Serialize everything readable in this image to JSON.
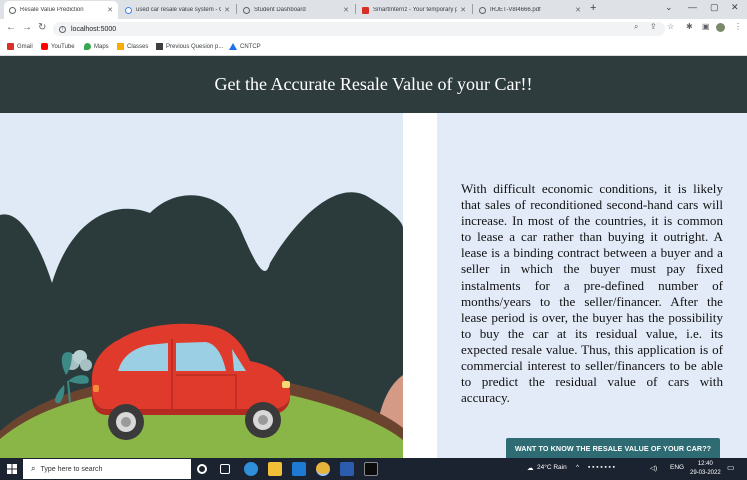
{
  "browser": {
    "tabs": [
      {
        "title": "Resale Value Prediction",
        "active": true,
        "favicon_color": "#1a73e8"
      },
      {
        "title": "used car resale value system - G",
        "active": false,
        "favicon_color": "#4285f4"
      },
      {
        "title": "Student Dashboard",
        "active": false,
        "favicon_color": "#5f6368"
      },
      {
        "title": "SmartInternz - Your temporary p",
        "active": false,
        "favicon_color": "#d93025"
      },
      {
        "title": "IRJET-V8I4666.pdf",
        "active": false,
        "favicon_color": "#5f6368"
      }
    ],
    "new_tab_label": "+",
    "address": "localhost:5000",
    "bookmarks": [
      {
        "label": "Gmail",
        "icon": "gmail-icon",
        "color": "#d93025"
      },
      {
        "label": "YouTube",
        "icon": "youtube-icon",
        "color": "#ff0000"
      },
      {
        "label": "Maps",
        "icon": "maps-icon",
        "color": "#34a853"
      },
      {
        "label": "Classes",
        "icon": "classes-icon",
        "color": "#f9ab00"
      },
      {
        "label": "Previous Quesion p...",
        "icon": "document-icon",
        "color": "#3c4043"
      },
      {
        "label": "CNTCP",
        "icon": "drive-icon",
        "color": "#1a73e8"
      }
    ]
  },
  "page": {
    "heading": "Get the Accurate Resale Value of your Car!!",
    "description": "With difficult economic conditions, it is likely that sales of reconditioned second-hand cars will increase. In most of the countries, it is common to lease a car rather than buying it outright. A lease is a binding contract between a buyer and a seller in which the buyer must pay fixed instalments for a pre-defined number of months/years to the seller/financer. After the lease period is over, the buyer has the possibility to buy the car at its residual value, i.e. its expected resale value. Thus, this application is of commercial interest to seller/financers to be able to predict the residual value of cars with accuracy.",
    "cta_label": "WANT TO KNOW THE RESALE VALUE OF YOUR CAR??",
    "colors": {
      "banner": "#2e3c3e",
      "cta": "#2e6b73",
      "car_body": "#e03a2c",
      "hill": "#8ab547",
      "panel": "#e3ebf8"
    }
  },
  "taskbar": {
    "search_placeholder": "Type here to search",
    "weather": "24°C  Rain",
    "language": "ENG",
    "time": "12:40",
    "date": "29-03-2022"
  }
}
